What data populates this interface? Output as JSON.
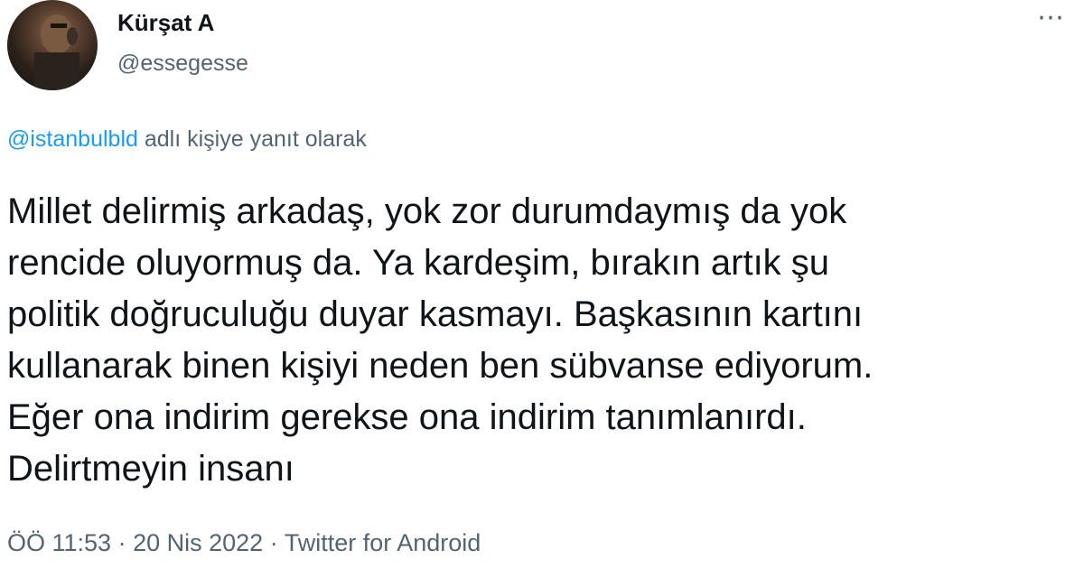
{
  "author": {
    "display_name": "Kürşat A",
    "username": "@essegesse"
  },
  "more_icon": "⋯",
  "reply": {
    "mention": "@istanbulbld",
    "suffix": " adlı kişiye yanıt olarak"
  },
  "tweet": {
    "text": "Millet delirmiş arkadaş, yok zor durumdaymış da yok\nrencide oluyormuş da. Ya kardeşim, bırakın artık şu\npolitik doğruculuğu duyar kasmayı. Başkasının kartını\nkullanarak binen kişiyi neden ben sübvanse ediyorum.\nEğer ona indirim gerekse ona indirim tanımlanırdı.\nDelirtmeyin insanı"
  },
  "meta": {
    "time": "ÖÖ 11:53",
    "sep1": " · ",
    "date": "20 Nis 2022",
    "sep2": " · ",
    "source": "Twitter for Android"
  }
}
